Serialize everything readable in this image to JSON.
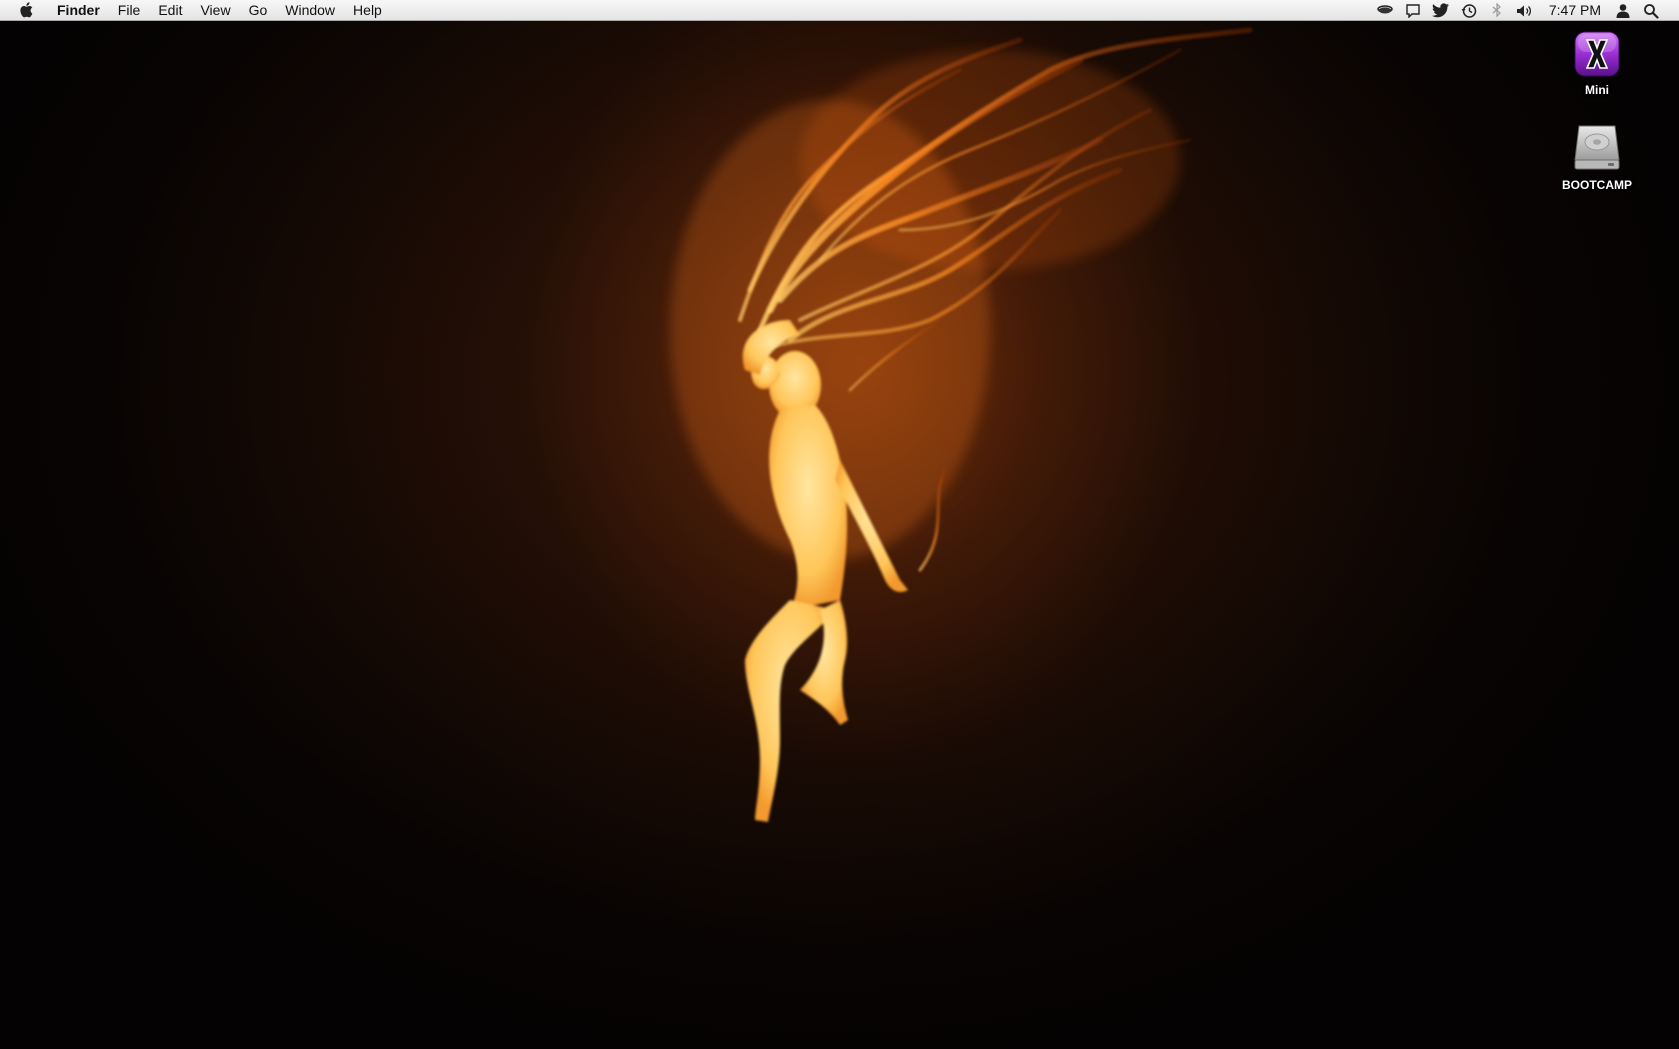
{
  "menubar": {
    "apple_icon": "apple-icon",
    "app_name": "Finder",
    "items": [
      "File",
      "Edit",
      "View",
      "Go",
      "Window",
      "Help"
    ],
    "status_icons": [
      "coffee-cup-icon",
      "chat-bubble-icon",
      "twitter-bird-icon",
      "time-machine-icon",
      "bluetooth-icon",
      "volume-icon"
    ],
    "clock": "7:47 PM",
    "user_icon": "user-icon",
    "spotlight_icon": "spotlight-search-icon"
  },
  "desktop": {
    "icons": [
      {
        "name": "Mini",
        "icon": "purple-x-app-icon"
      },
      {
        "name": "BOOTCAMP",
        "icon": "hard-drive-icon"
      }
    ],
    "wallpaper": "fire-woman-wallpaper"
  },
  "colors": {
    "flame": "#ff8a1f",
    "glow": "#ffd27a",
    "background": "#050302",
    "menubar": "#ececec"
  }
}
